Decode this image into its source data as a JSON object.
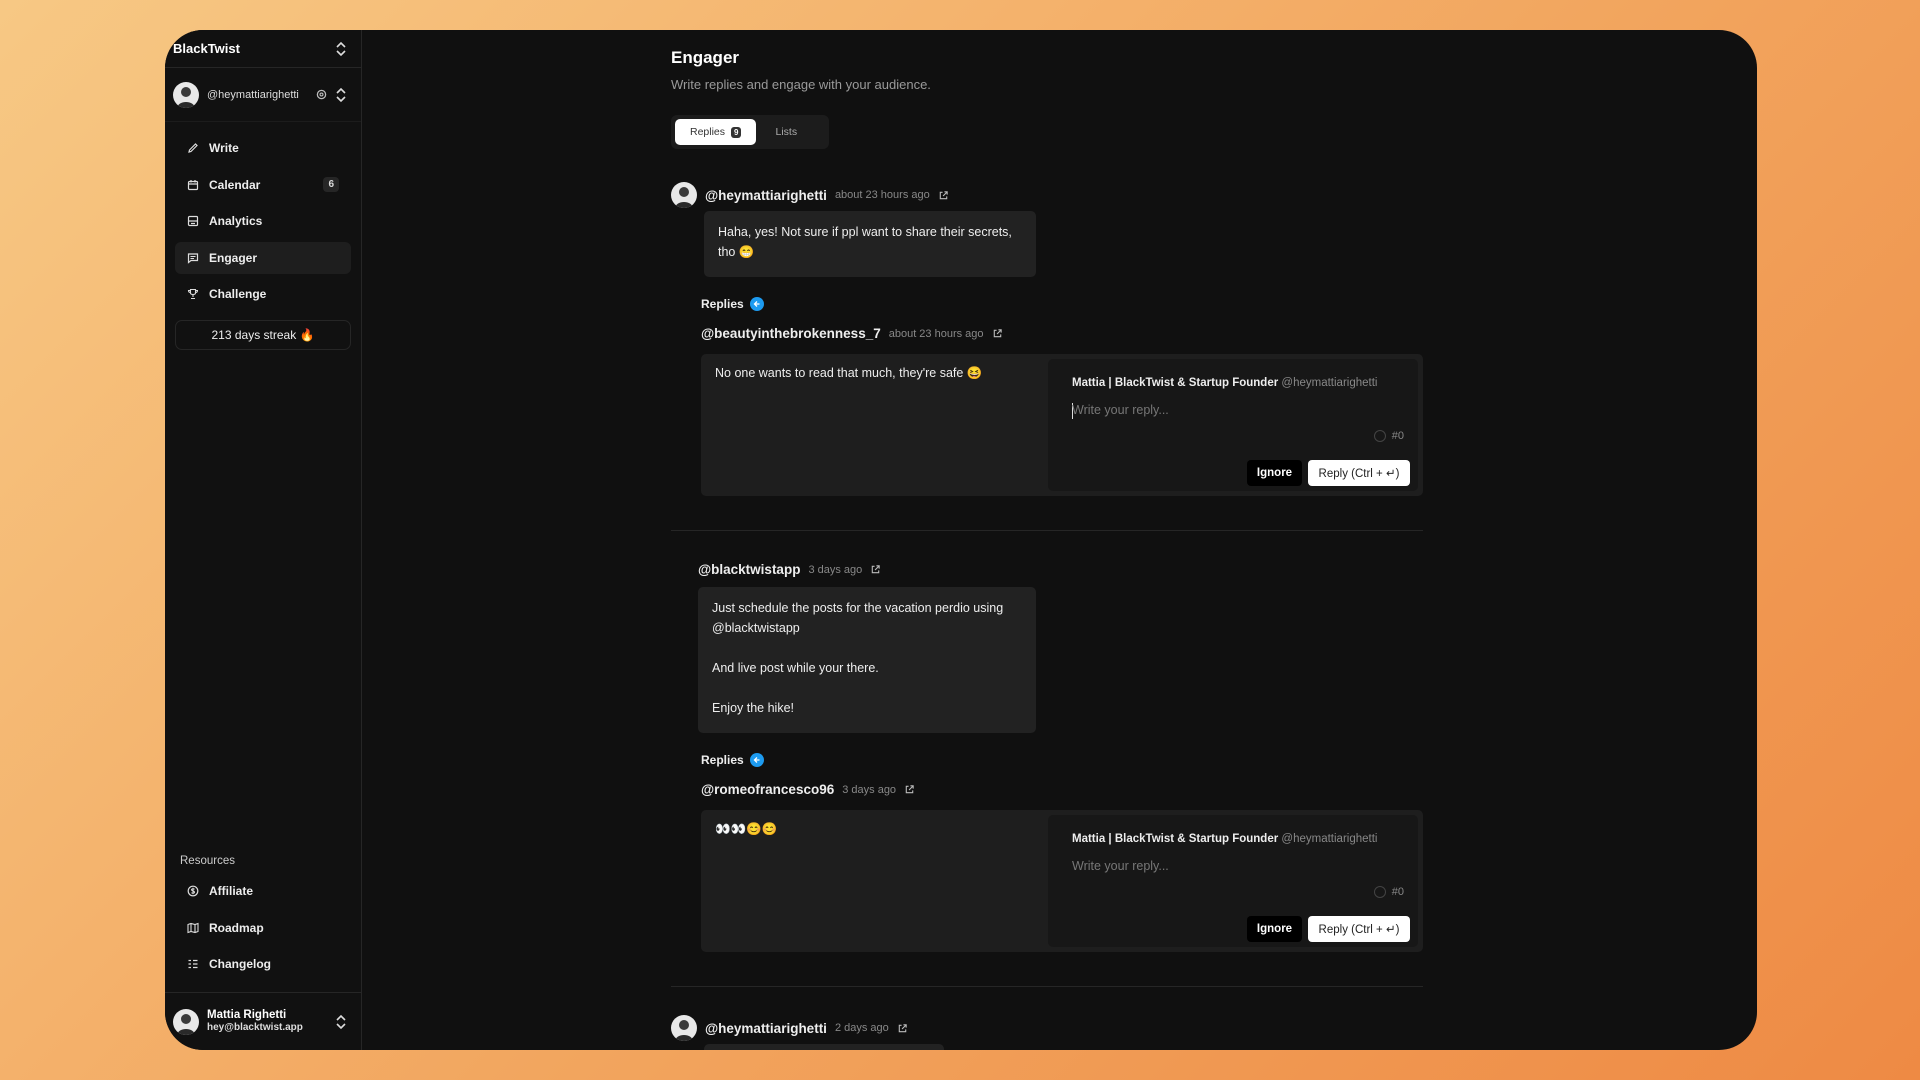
{
  "sidebar": {
    "workspace": "BlackTwist",
    "account_handle": "@heymattiarighetti",
    "nav": [
      {
        "label": "Write",
        "icon": "pencil-icon"
      },
      {
        "label": "Calendar",
        "icon": "calendar-icon",
        "badge": "6"
      },
      {
        "label": "Analytics",
        "icon": "analytics-icon"
      },
      {
        "label": "Engager",
        "icon": "chat-icon",
        "active": true
      },
      {
        "label": "Challenge",
        "icon": "trophy-icon"
      }
    ],
    "streak": "213 days streak 🔥",
    "resources_title": "Resources",
    "resources": [
      {
        "label": "Affiliate",
        "icon": "dollar-icon"
      },
      {
        "label": "Roadmap",
        "icon": "map-icon"
      },
      {
        "label": "Changelog",
        "icon": "changelog-icon"
      }
    ],
    "user": {
      "name": "Mattia Righetti",
      "email": "hey@blacktwist.app"
    }
  },
  "page": {
    "title": "Engager",
    "subtitle": "Write replies and engage with your audience.",
    "tabs": [
      {
        "label": "Replies",
        "badge": "9"
      },
      {
        "label": "Lists"
      }
    ]
  },
  "threads": [
    {
      "author": "@heymattiarighetti",
      "time": "about 23 hours ago",
      "text": "Haha, yes! Not sure if ppl want to share their secrets, tho 😁",
      "replies_label": "Replies",
      "reply": {
        "author": "@beautyinthebrokenness_7",
        "time": "about 23 hours ago",
        "text": "No one wants to read that much, they're safe 😆"
      },
      "composer": {
        "author": "Mattia | BlackTwist & Startup Founder",
        "handle": "@heymattiarighetti",
        "placeholder": "Write your reply...",
        "count": "#0",
        "ignore": "Ignore",
        "reply": "Reply (Ctrl + ↵)"
      }
    },
    {
      "author": "@blacktwistapp",
      "time": "3 days ago",
      "text": [
        "Just schedule the posts for the vacation perdio using",
        "@blacktwistapp",
        "",
        "And live post while your there.",
        "",
        "Enjoy the hike!"
      ],
      "replies_label": "Replies",
      "reply": {
        "author": "@romeofrancesco96",
        "time": "3 days ago",
        "text": "👀👀😊😊"
      },
      "composer": {
        "author": "Mattia | BlackTwist & Startup Founder",
        "handle": "@heymattiarighetti",
        "placeholder": "Write your reply...",
        "count": "#0",
        "ignore": "Ignore",
        "reply": "Reply (Ctrl + ↵)"
      }
    },
    {
      "author": "@heymattiarighetti",
      "time": "2 days ago"
    }
  ]
}
